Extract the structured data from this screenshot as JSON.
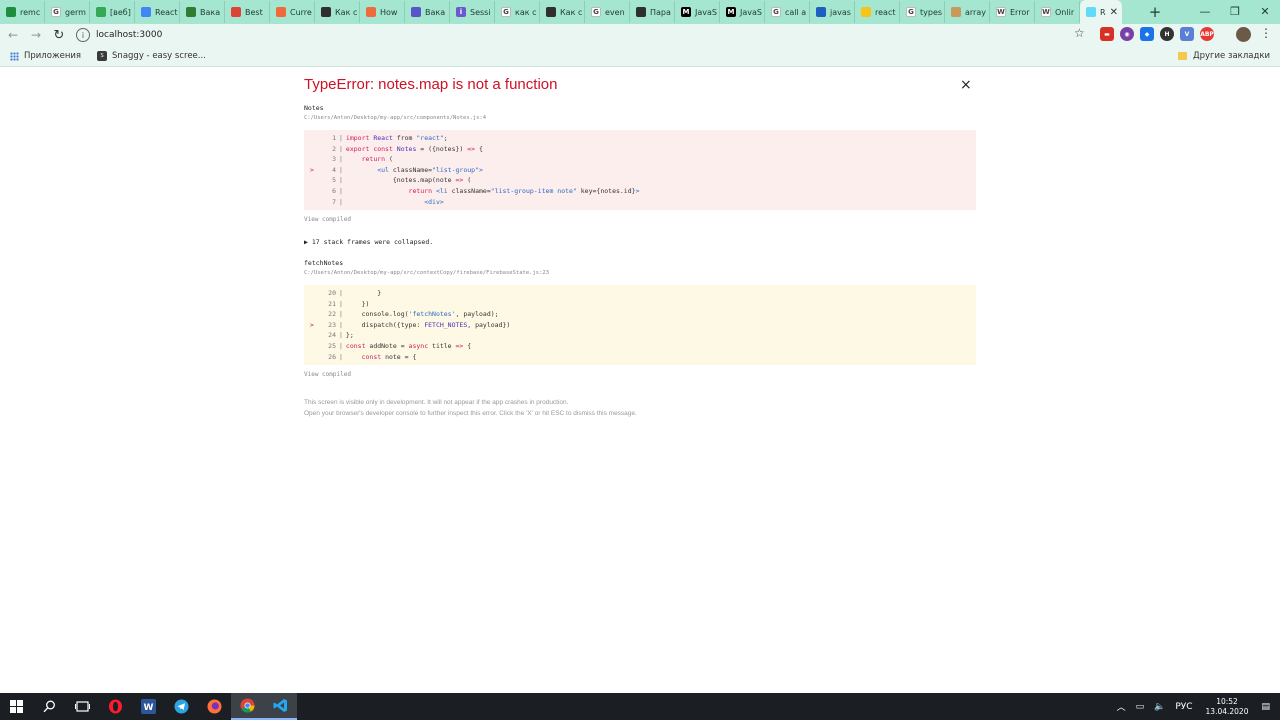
{
  "browser": {
    "tabs": [
      {
        "label": "remc",
        "fav": "green"
      },
      {
        "label": "germ",
        "fav": "g"
      },
      {
        "label": "[веб]",
        "fav": "drive"
      },
      {
        "label": "React",
        "fav": "doc"
      },
      {
        "label": "Вака",
        "fav": "green2"
      },
      {
        "label": "Best",
        "fav": "chrome"
      },
      {
        "label": "Curre",
        "fav": "orange"
      },
      {
        "label": "Как с",
        "fav": "dark"
      },
      {
        "label": "How",
        "fav": "orange"
      },
      {
        "label": "Вака",
        "fav": "purple"
      },
      {
        "label": "Sessi",
        "fav": "i"
      },
      {
        "label": "как с",
        "fav": "g"
      },
      {
        "label": "Как с",
        "fav": "dark"
      },
      {
        "label": "even",
        "fav": "g"
      },
      {
        "label": "Пара",
        "fav": "dark"
      },
      {
        "label": "JavaS",
        "fav": "m"
      },
      {
        "label": "JavaS",
        "fav": "m"
      },
      {
        "label": "call a",
        "fav": "g"
      },
      {
        "label": "javas",
        "fav": "blue"
      },
      {
        "label": "react",
        "fav": "yellow"
      },
      {
        "label": "types",
        "fav": "g"
      },
      {
        "label": "array",
        "fav": "tan"
      },
      {
        "label": "Error",
        "fav": "w"
      },
      {
        "label": "Onlir",
        "fav": "w"
      },
      {
        "label": "R",
        "fav": "react",
        "active": true
      }
    ],
    "new_tab_label": "+",
    "window_controls": {
      "minimize": "—",
      "maximize": "❐",
      "close": "✕"
    },
    "address": "localhost:3000",
    "bookmarks": [
      {
        "label": "Приложения"
      },
      {
        "label": "Snaggy - easy scree..."
      }
    ],
    "other_bookmarks": "Другие закладки"
  },
  "overlay": {
    "title": "TypeError: notes.map is not a function",
    "close_label": "×",
    "frames": [
      {
        "name": "Notes",
        "path": "C:/Users/Anton/Desktop/my-app/src/components/Notes.js:4",
        "style": "red",
        "lines": [
          {
            "n": "1",
            "mark": "",
            "code": [
              [
                "kw",
                "import "
              ],
              [
                "var",
                "React "
              ],
              [
                "plain",
                "from "
              ],
              [
                "str",
                "\"react\""
              ],
              [
                "plain",
                ";"
              ]
            ]
          },
          {
            "n": "2",
            "mark": "",
            "code": [
              [
                "kw",
                "export const "
              ],
              [
                "var",
                "Notes "
              ],
              [
                "plain",
                "= ({notes}) "
              ],
              [
                "kw",
                "=> "
              ],
              [
                "plain",
                "{"
              ]
            ]
          },
          {
            "n": "3",
            "mark": "",
            "code": [
              [
                "plain",
                "    "
              ],
              [
                "kw",
                "return "
              ],
              [
                "plain",
                "("
              ]
            ]
          },
          {
            "n": "4",
            "mark": ">",
            "code": [
              [
                "plain",
                "        "
              ],
              [
                "str",
                "<ul "
              ],
              [
                "plain",
                "className="
              ],
              [
                "str",
                "\"list-group\""
              ],
              [
                "str",
                ">"
              ]
            ]
          },
          {
            "n": "5",
            "mark": "",
            "code": [
              [
                "plain",
                "            {notes.map(note "
              ],
              [
                "kw",
                "=> "
              ],
              [
                "plain",
                "("
              ]
            ]
          },
          {
            "n": "6",
            "mark": "",
            "code": [
              [
                "plain",
                "                "
              ],
              [
                "kw",
                "return "
              ],
              [
                "str",
                "<li "
              ],
              [
                "plain",
                "className="
              ],
              [
                "str",
                "\"list-group-item note\" "
              ],
              [
                "plain",
                "key={notes.id}"
              ],
              [
                "str",
                ">"
              ]
            ]
          },
          {
            "n": "7",
            "mark": "",
            "code": [
              [
                "plain",
                "                    "
              ],
              [
                "str",
                "<div>"
              ]
            ]
          }
        ],
        "view_compiled": "View compiled"
      },
      {
        "name": "fetchNotes",
        "path": "C:/Users/Anton/Desktop/my-app/src/contextCopy/firebase/FirebaseState.js:23",
        "style": "yellow",
        "lines": [
          {
            "n": "20",
            "mark": "",
            "code": [
              [
                "plain",
                "        }"
              ]
            ]
          },
          {
            "n": "21",
            "mark": "",
            "code": [
              [
                "plain",
                "    })"
              ]
            ]
          },
          {
            "n": "22",
            "mark": "",
            "code": [
              [
                "plain",
                "    console.log("
              ],
              [
                "str",
                "'fetchNotes'"
              ],
              [
                "plain",
                ", payload);"
              ]
            ]
          },
          {
            "n": "23",
            "mark": ">",
            "code": [
              [
                "plain",
                "    dispatch({type: "
              ],
              [
                "var",
                "FETCH_NOTES"
              ],
              [
                "plain",
                ", payload})"
              ]
            ]
          },
          {
            "n": "24",
            "mark": "",
            "code": [
              [
                "plain",
                "};"
              ]
            ]
          },
          {
            "n": "25",
            "mark": "",
            "code": [
              [
                "kw",
                "const "
              ],
              [
                "plain",
                "addNote = "
              ],
              [
                "kw",
                "async "
              ],
              [
                "plain",
                "title "
              ],
              [
                "kw",
                "=> "
              ],
              [
                "plain",
                "{"
              ]
            ]
          },
          {
            "n": "26",
            "mark": "",
            "code": [
              [
                "plain",
                "    "
              ],
              [
                "kw",
                "const "
              ],
              [
                "plain",
                "note = {"
              ]
            ]
          }
        ],
        "view_compiled": "View compiled"
      }
    ],
    "collapsed": "▶ 17 stack frames were collapsed.",
    "footer": [
      "This screen is visible only in development. It will not appear if the app crashes in production.",
      "Open your browser's developer console to further inspect this error.  Click the 'X' or hit ESC to dismiss this message."
    ]
  },
  "taskbar": {
    "lang": "РУС",
    "time": "10:52",
    "date": "13.04.2020"
  },
  "colors": {
    "tab_strip": "#a4e6cf",
    "toolbar": "#eaf6f1",
    "error_red": "#ce1126",
    "code_red_bg": "#fdeeee",
    "code_yellow_bg": "#fdf9e4",
    "taskbar": "#1b1f23"
  }
}
